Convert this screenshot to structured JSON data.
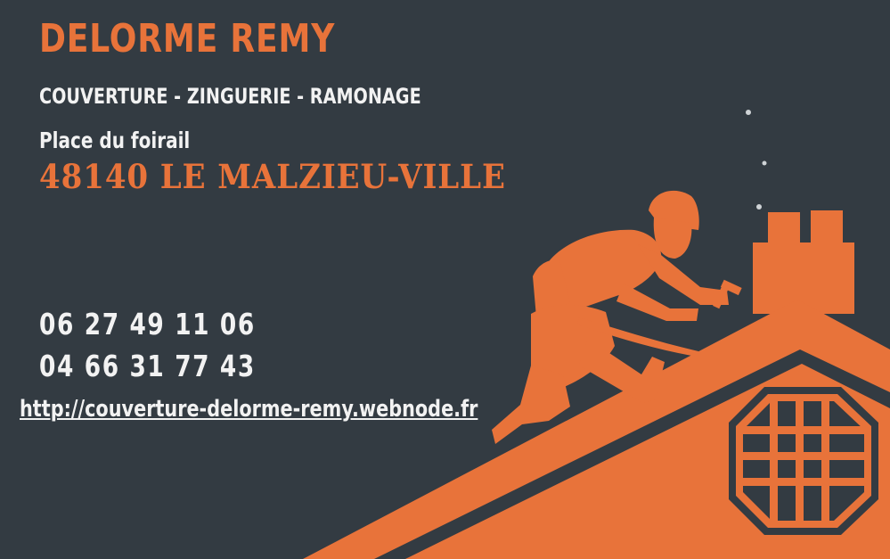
{
  "card": {
    "name": "DELORME REMY",
    "services": "COUVERTURE - ZINGUERIE - RAMONAGE",
    "street": "Place du foirail",
    "city": "48140 LE MALZIEU-VILLE",
    "phones": [
      "06 27 49 11 06",
      "04 66 31 77 43"
    ],
    "website": "http://couverture-delorme-remy.webnode.fr"
  },
  "colors": {
    "background": "#333b42",
    "accent": "#e8733a",
    "text": "#f2f2f2"
  },
  "illustration": {
    "icons": [
      "roofer-silhouette-icon",
      "roof-icon",
      "chimney-icon",
      "octagonal-window-icon",
      "smoke-icon"
    ]
  }
}
